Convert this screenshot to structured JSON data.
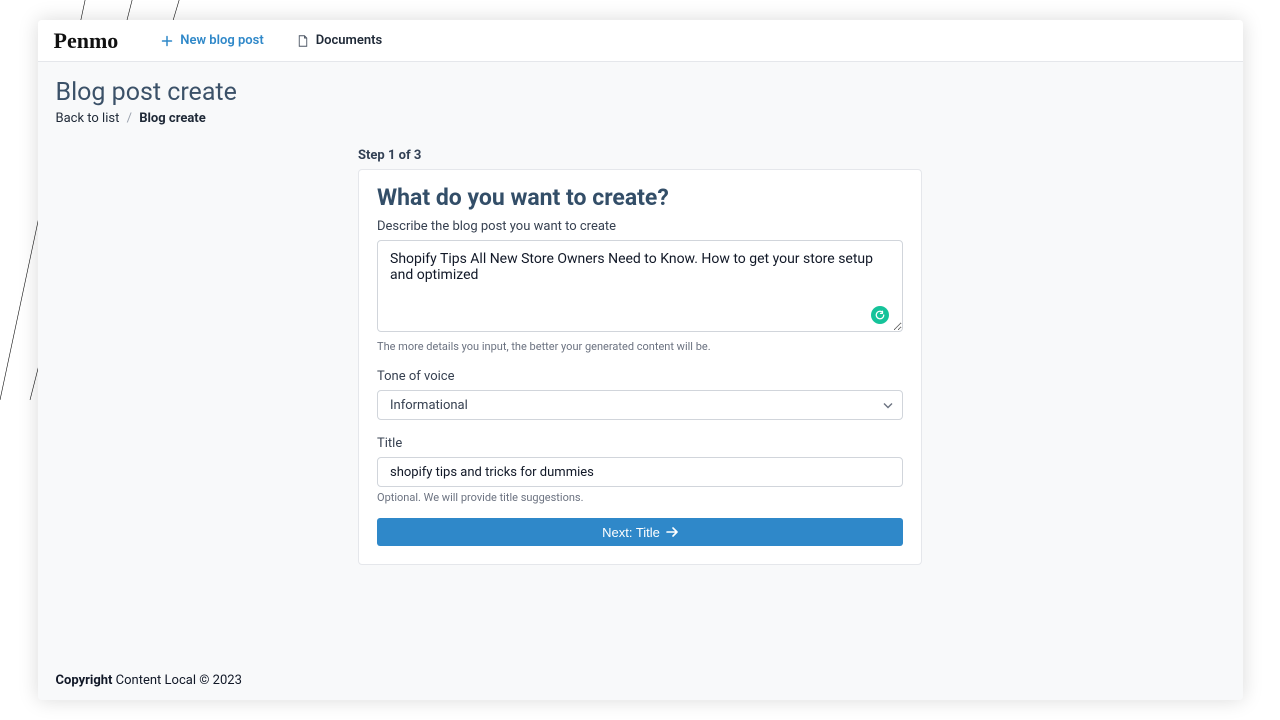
{
  "brand": {
    "logo": "Penmo"
  },
  "nav": {
    "new_post_label": "New blog post",
    "documents_label": "Documents"
  },
  "page": {
    "title": "Blog post create",
    "breadcrumb": {
      "back_label": "Back to list",
      "separator": "/",
      "current": "Blog create"
    }
  },
  "step": {
    "indicator": "Step 1 of 3",
    "heading": "What do you want to create?",
    "describe_label": "Describe the blog post you want to create",
    "describe_value": "Shopify Tips All New Store Owners Need to Know. How to get your store setup and optimized",
    "describe_hint": "The more details you input, the better your generated content will be.",
    "tone_label": "Tone of voice",
    "tone_value": "Informational",
    "title_label": "Title",
    "title_value": "shopify tips and tricks for dummies",
    "title_hint": "Optional. We will provide title suggestions.",
    "next_button": "Next: Title"
  },
  "footer": {
    "copyright_bold": "Copyright",
    "copyright_rest": " Content Local © 2023"
  }
}
